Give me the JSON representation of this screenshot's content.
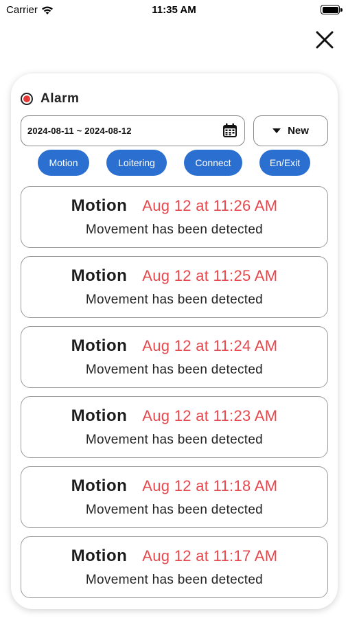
{
  "status_bar": {
    "carrier": "Carrier",
    "time": "11:35 AM"
  },
  "alarm": {
    "title": "Alarm",
    "indicator_color": "#e53935"
  },
  "filters": {
    "date_range": "2024-08-11 ~ 2024-08-12",
    "sort_label": "New",
    "chips": [
      "Motion",
      "Loitering",
      "Connect",
      "En/Exit"
    ],
    "chip_color": "#2b6fd1"
  },
  "events": [
    {
      "type": "Motion",
      "time": "Aug 12 at 11:26 AM",
      "description": "Movement has been detected"
    },
    {
      "type": "Motion",
      "time": "Aug 12 at 11:25 AM",
      "description": "Movement has been detected"
    },
    {
      "type": "Motion",
      "time": "Aug 12 at 11:24 AM",
      "description": "Movement has been detected"
    },
    {
      "type": "Motion",
      "time": "Aug 12 at 11:23 AM",
      "description": "Movement has been detected"
    },
    {
      "type": "Motion",
      "time": "Aug 12 at 11:18 AM",
      "description": "Movement has been detected"
    },
    {
      "type": "Motion",
      "time": "Aug 12 at 11:17 AM",
      "description": "Movement has been detected"
    }
  ],
  "icons": {
    "wifi": "wifi-icon",
    "battery": "battery-icon",
    "close": "close-icon",
    "calendar": "calendar-icon",
    "dropdown": "caret-down-icon"
  },
  "time_color": "#e5484d"
}
